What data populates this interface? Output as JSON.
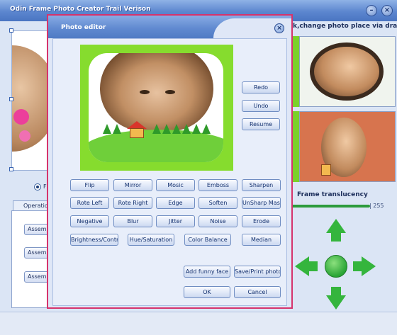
{
  "main": {
    "title": "Odin Frame Photo Creator Trail Verison",
    "minimize": "–",
    "close": "×",
    "change_hint": "k,change photo place via drag it",
    "radio_label": "F",
    "operation_tab": "Operation",
    "assemble_buttons": [
      "Assemble",
      "Assemble",
      "Assemble"
    ],
    "frame_translucency_label": "Frame translucency",
    "slider_value": "255",
    "slider_fraction": 1.0
  },
  "dialog": {
    "title": "Photo editor",
    "close": "×",
    "side_buttons": [
      "Redo",
      "Undo",
      "Resume"
    ],
    "effect_rows": [
      [
        "Flip",
        "Mirror",
        "Mosic",
        "Emboss",
        "Sharpen"
      ],
      [
        "Rote Left",
        "Rote Right",
        "Edge",
        "Soften",
        "UnSharp Mask"
      ],
      [
        "Negative",
        "Blur",
        "Jitter",
        "Noise",
        "Erode"
      ]
    ],
    "adjust_buttons": [
      "Brightness/Contrast",
      "Hue/Saturation",
      "Color Balance",
      "Median"
    ],
    "add_funny_face": "Add funny face",
    "save_print": "Save/Print photo",
    "ok": "OK",
    "cancel": "Cancel"
  },
  "colors": {
    "frame_green": "#86dc2e",
    "dialog_border": "#d6336c",
    "arrow_green": "#35b53d",
    "title_blue": "#5c86cf"
  },
  "icons": [
    "minimize-icon",
    "close-icon",
    "arrow-up-icon",
    "arrow-down-icon",
    "arrow-left-icon",
    "arrow-right-icon",
    "center-icon"
  ]
}
